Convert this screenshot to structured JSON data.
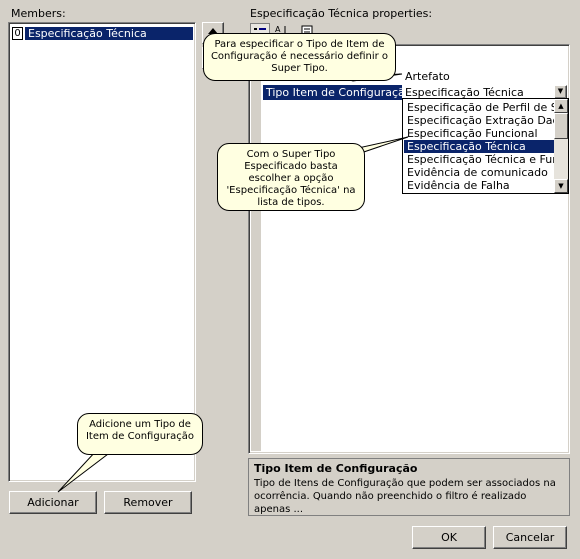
{
  "members": {
    "label": "Members:",
    "items": [
      {
        "index": "0",
        "name": "Especificação Técnica"
      }
    ],
    "add_label": "Adicionar",
    "remove_label": "Remover"
  },
  "properties": {
    "label": "Especificação Técnica properties:",
    "rows": [
      {
        "name": "",
        "value": "Artefato"
      },
      {
        "name": "Tipo Item de Configuração",
        "value": "Especificação Técnica"
      }
    ],
    "dropdown_options": [
      "Especificação de Perfil de Siste",
      "Especificação Extração Dados",
      "Especificação Funcional",
      "Especificação Técnica",
      "Especificação Técnica e Funci",
      "Evidência de comunicado",
      "Evidência de Falha"
    ],
    "selected_option_index": 3,
    "description_title": "Tipo Item de Configuração",
    "description_text": "Tipo de Itens de Configuração que podem ser associados na ocorrência. Quando não preenchido o filtro é realizado apenas ..."
  },
  "tooltips": {
    "super_tipo": "Para especificar o Tipo de Item de Configuração é necessário definir o Super Tipo.",
    "escolher": "Com o Super Tipo Especificado basta escolher a opção 'Especificação Técnica' na lista de tipos.",
    "adicione": "Adicione um Tipo de Item de Configuração"
  },
  "footer": {
    "ok_label": "OK",
    "cancel_label": "Cancelar"
  },
  "icons": [
    "categorized-icon",
    "sort-alpha-icon",
    "property-pages-icon",
    "arrow-up-icon",
    "arrow-down-icon",
    "dropdown-arrow-icon"
  ]
}
